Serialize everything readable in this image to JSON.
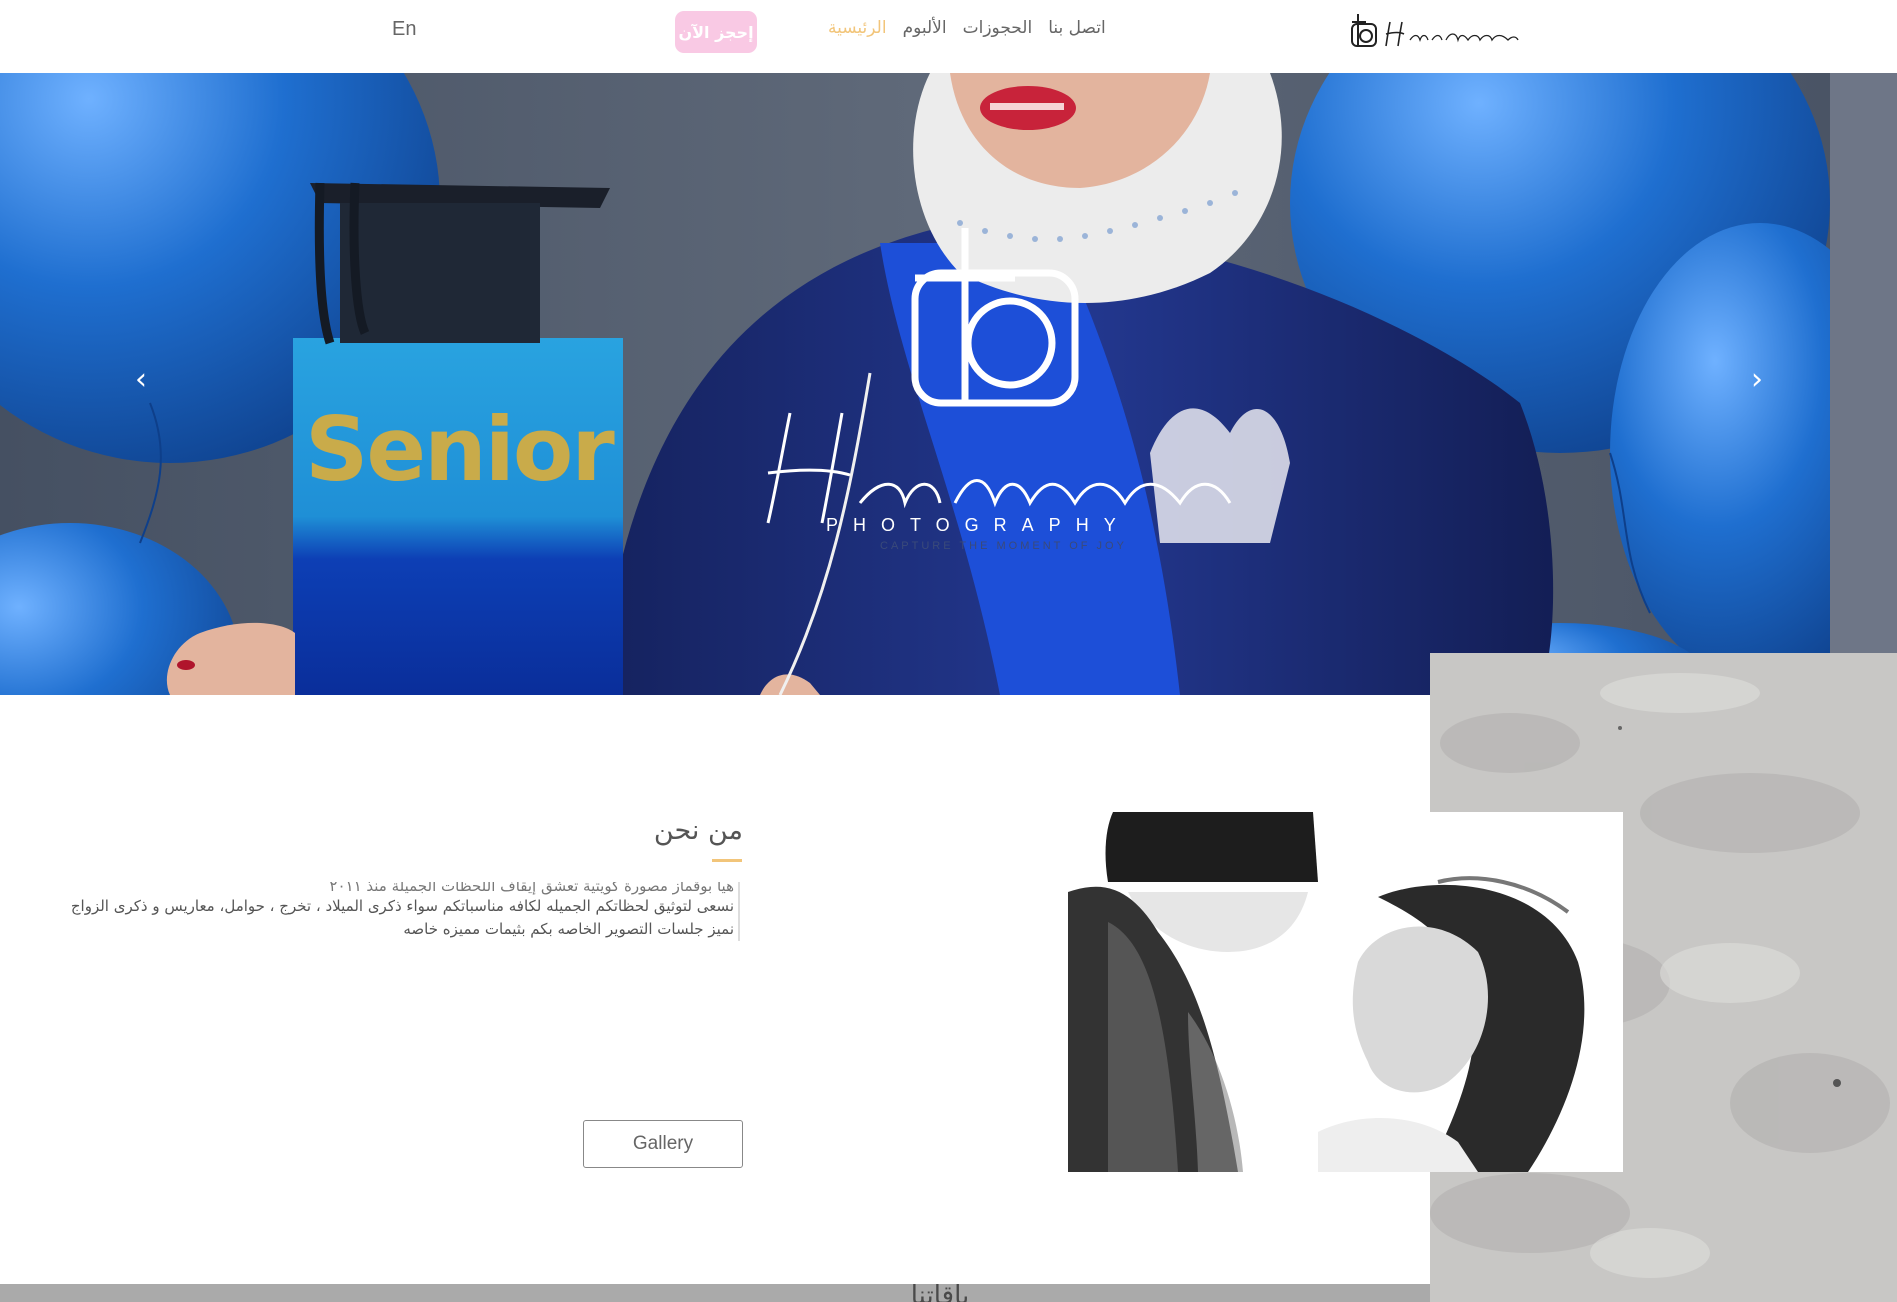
{
  "header": {
    "lang_toggle": "En",
    "book_now": "إحجز الآن",
    "nav": [
      {
        "label": "الرئيسية",
        "active": true
      },
      {
        "label": "الألبوم",
        "active": false
      },
      {
        "label": "الحجوزات",
        "active": false
      },
      {
        "label": "اتصل بنا",
        "active": false
      }
    ]
  },
  "hero": {
    "tagline": "PHOTOGRAPHY",
    "sub_tagline": "CAPTURE THE MOMENT OF JOY",
    "cake_text": "Senior",
    "prev_icon": "chevron-left-icon",
    "next_icon": "chevron-right-icon"
  },
  "about": {
    "title": "من نحن",
    "lines": [
      "هيا بوقماز مصورة كويتية تعشق إيقاف اللحظات الجميلة منذ ٢٠١١",
      "نسعى لتوثيق لحظاتكم الجميله لكافه مناسباتكم سواء ذكرى الميلاد ، تخرج ، حوامل، معاريس و ذكرى الزواج",
      "نميز جلسات التصوير الخاصه بكم بثيمات مميزه خاصه"
    ],
    "gallery_button": "Gallery"
  },
  "packages": {
    "title": "باقاتنا"
  },
  "colors": {
    "accent": "#f2c57a",
    "book_button": "#f9c9e4",
    "balloon": "#1f6fd0",
    "gown": "#1c2f7a"
  }
}
